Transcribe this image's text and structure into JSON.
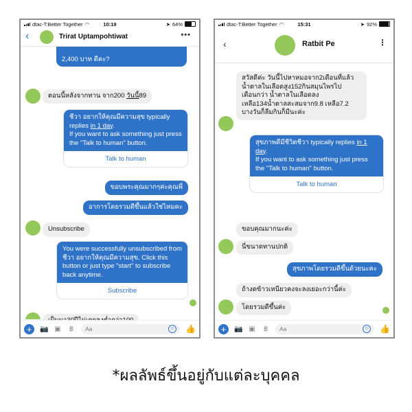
{
  "status_left": {
    "carrier": "dtac-T:Better Together",
    "time": "10:19",
    "battery": "64%",
    "battery_level": 0.64
  },
  "status_right": {
    "carrier": "dtac-T:Better Together",
    "time": "15:31",
    "battery": "92%",
    "battery_level": 0.92
  },
  "chat_left": {
    "contact_name": "Trirat Uptampohtiwat",
    "back_glyph": "‹",
    "menu_glyph": "•••",
    "msg_partial": "2,400 บาท ดีคะ?",
    "msg_1": "ตอนนี้หลังจากทาน จาก200 ",
    "msg_1_link": "วันนี้",
    "msg_1_tail": "89",
    "card_1_text_a": "ชีวา อยากให้คุณมีความสุข typically replies ",
    "card_1_link": "in 1 day",
    "card_1_text_b": ".\n If you want to ask something just press the \"Talk to human\" button.",
    "card_1_button": "Talk to human",
    "msg_2": "ขอบพระคุณมากๆค่ะคุณพี่",
    "msg_3": "อาการโดยรวมดีขึ้นแล้วใช่ไหมคะ",
    "msg_4": "Unsubscribe",
    "card_2_text": "You were successfully unsubscribed from ชีวา อยากให้คุณมีความสุข. Click this button or just type \"start\" to subscribe back anytime.",
    "card_2_button": "Subscribe",
    "msg_5": "เป็นมา30ปีไม่เคยลงต่ำกว่า100",
    "composer_placeholder": "Aa"
  },
  "chat_right": {
    "contact_name": "Ratbit Pe",
    "back_glyph": "‹",
    "menu_glyph": "⋮",
    "msg_1": "สวัสดีค่ะ วันนี้ไปหาหมอจาก2เดือนที่แล้ว\nน้ำตาลในเลือดสูง152กินสมุนไพรไป\nเดือนกว่า น้ำตาลในเลือดลง\nเหลือ134น้ำตาลสะสมจาก9.8 เหลือ7.2\nบางวันก็ลืมกินก็มีนะค่ะ",
    "card_1_text_a": "สุขภาพดีมีชีวิตชีวา typically replies ",
    "card_1_link": "in 1 day",
    "card_1_text_b": ".\n If you want to ask something just press the \"Talk to human\" button.",
    "card_1_button": "Talk to human",
    "msg_2": "ขอบคุณมากนะค่ะ",
    "msg_3": "นี่ขนาดทานปกติ",
    "msg_4": "สุขภาพโดยรวมดีขึ้นด้วยนะคะ",
    "msg_5": "ถ้างดข้าวเหนียวคงจะลงเยอะกว่านี้ค่ะ",
    "msg_6": "โดยรวมดีขึ้นค่ะ",
    "composer_placeholder": "Aa"
  },
  "icons": {
    "camera": "📷",
    "image": "▣",
    "baht": "฿",
    "emoji": "☺",
    "like": "👍",
    "plus": "+"
  },
  "caption": "*ผลลัพธ์ขึ้นอยู่กับแต่ละบุคคล"
}
